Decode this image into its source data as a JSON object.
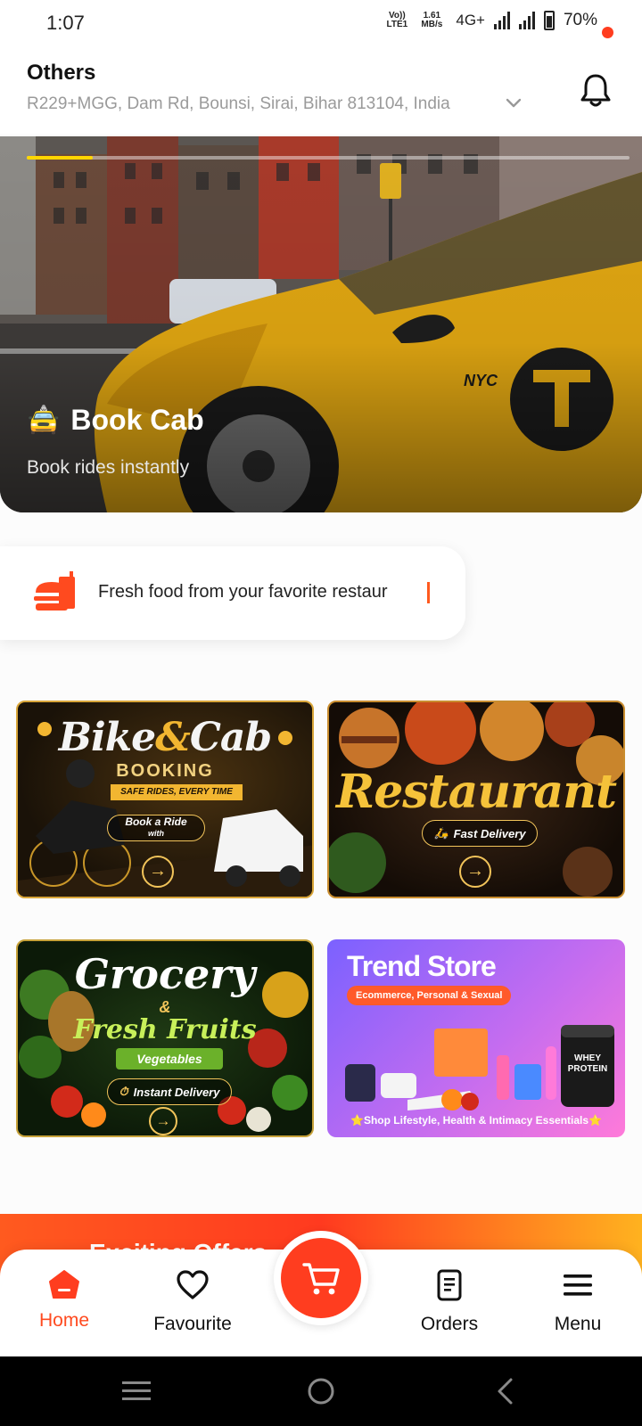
{
  "status_bar": {
    "time": "1:07",
    "volte": "Vo)) LTE1",
    "speed": "1.61 MB/s",
    "network": "4G+",
    "battery": "70%"
  },
  "header": {
    "title": "Others",
    "address": "R229+MGG, Dam Rd, Bounsi, Sirai, Bihar 813104, India"
  },
  "hero": {
    "emoji": "🚖",
    "title": "Book Cab",
    "subtitle": "Book rides instantly",
    "slide_progress": 0.11
  },
  "food_chip": {
    "text": "Fresh food from your favorite restaur"
  },
  "tiles": {
    "bike": {
      "title_a": "Bike",
      "title_amp": "&",
      "title_b": "Cab",
      "subtitle": "BOOKING",
      "ribbon": "SAFE RIDES, EVERY TIME",
      "pill": "Book a Ride",
      "pill_sub": "with"
    },
    "restaurant": {
      "title": "Restaurant",
      "pill": "Fast Delivery"
    },
    "grocery": {
      "title": "Grocery",
      "amp": "&",
      "subtitle": "Fresh Fruits",
      "ribbon": "Vegetables",
      "pill": "Instant Delivery"
    },
    "trend": {
      "title": "Trend Store",
      "tag": "Ecommerce, Personal & Sexual",
      "footer": "⭐Shop Lifestyle, Health & Intimacy Essentials⭐",
      "product_label": "WHEY PROTEIN"
    }
  },
  "promo": {
    "text": "Exciting Offers"
  },
  "bottom_nav": {
    "items": [
      {
        "label": "Home",
        "icon": "home-icon",
        "active": true
      },
      {
        "label": "Favourite",
        "icon": "heart-icon"
      },
      {
        "label": "Orders",
        "icon": "orders-icon"
      },
      {
        "label": "Menu",
        "icon": "menu-icon"
      }
    ],
    "cart_icon": "cart-icon"
  },
  "colors": {
    "accent": "#ff3d1f",
    "hero_progress": "#ffd600",
    "gold": "#f2b631"
  }
}
